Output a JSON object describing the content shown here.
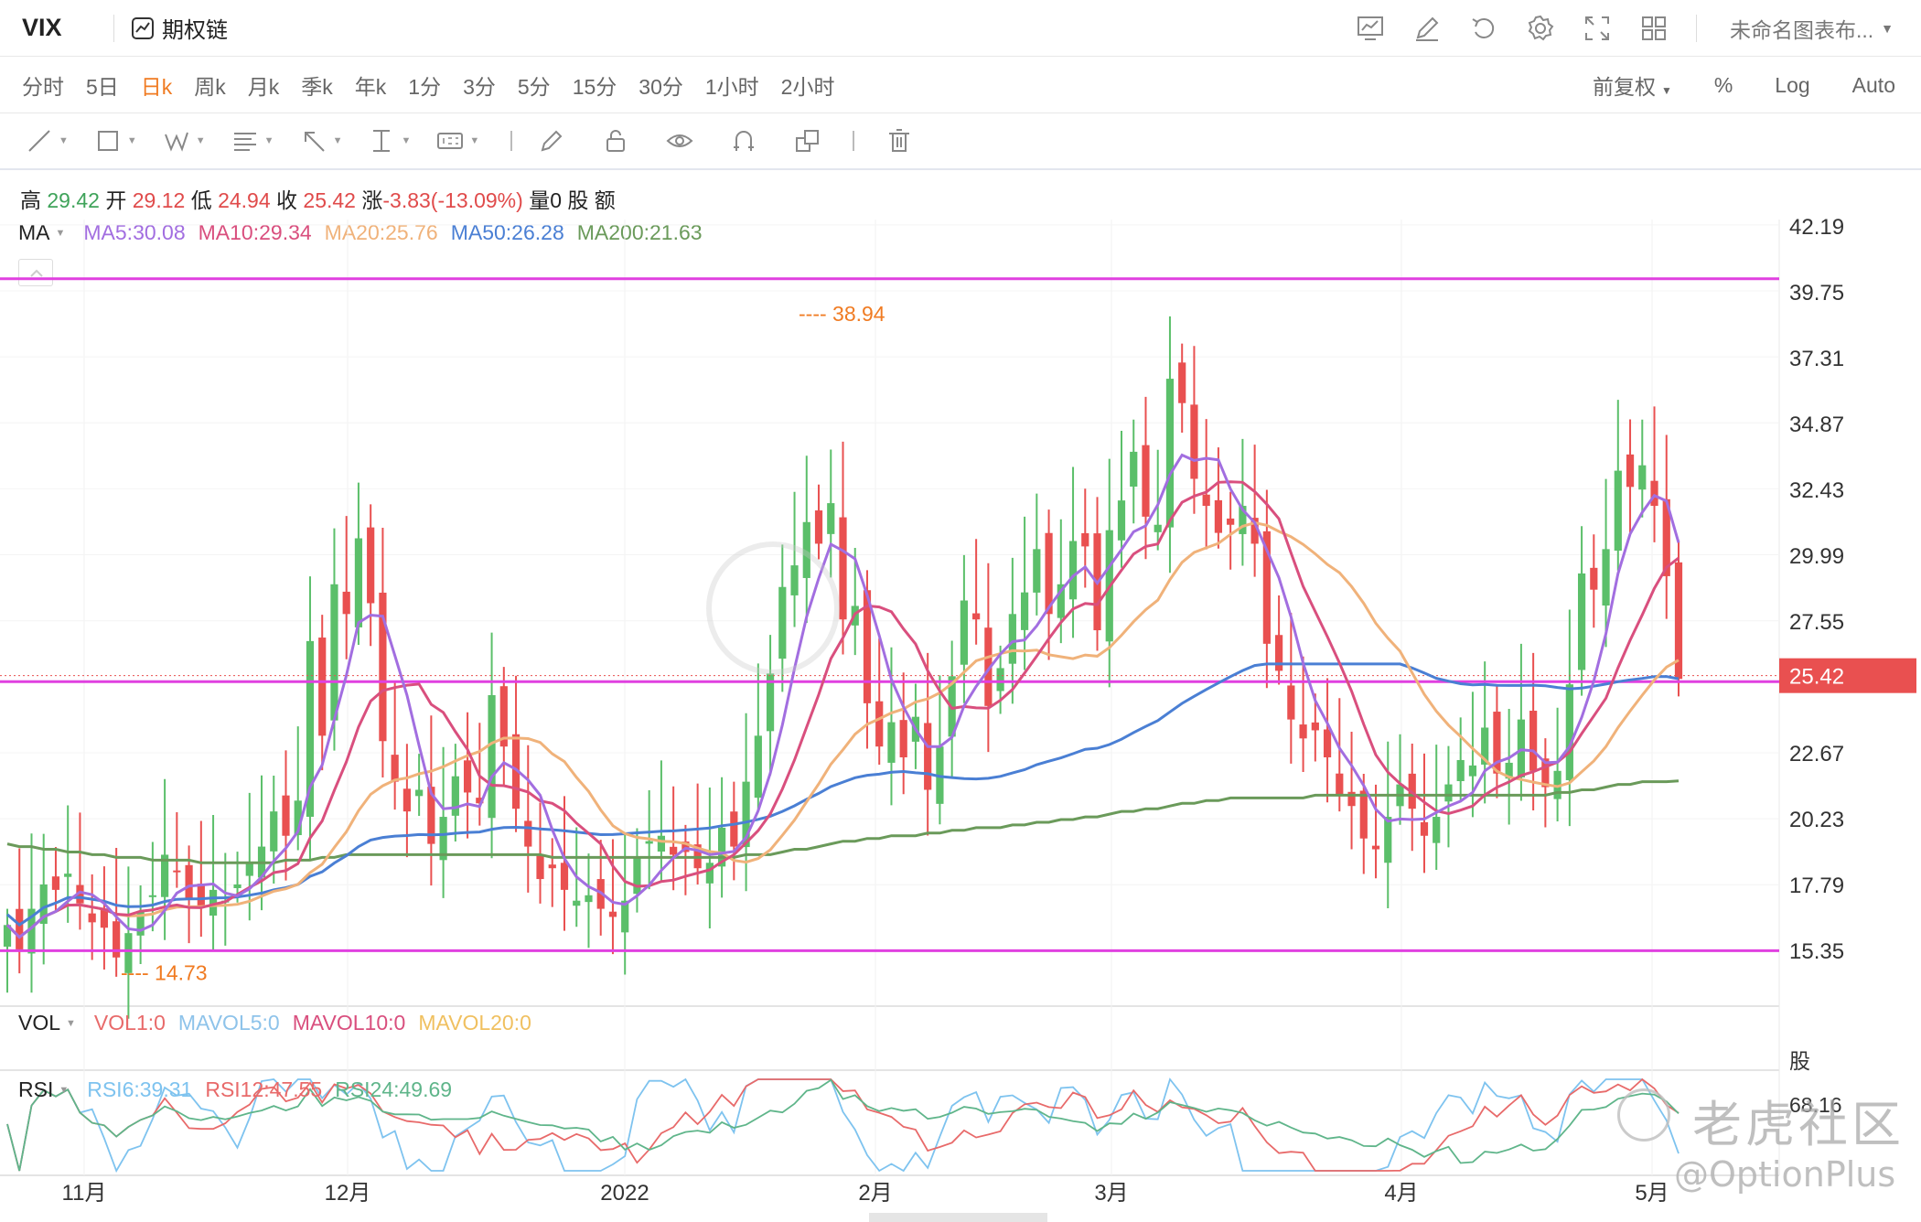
{
  "header": {
    "symbol": "VIX",
    "option_chain": "期权链",
    "layout_name": "未命名图表布...",
    "icons": [
      "indicator-icon",
      "draw-icon",
      "undo-icon",
      "settings-icon",
      "fullscreen-icon",
      "layout-grid-icon"
    ]
  },
  "periods": {
    "items": [
      "分时",
      "5日",
      "日k",
      "周k",
      "月k",
      "季k",
      "年k",
      "1分",
      "3分",
      "5分",
      "15分",
      "30分",
      "1小时",
      "2小时"
    ],
    "active": "日k",
    "right": [
      "前复权",
      "%",
      "Log",
      "Auto"
    ]
  },
  "tools": [
    "line-tool-icon",
    "rect-tool-icon",
    "pattern-tool-icon",
    "fib-tool-icon",
    "arrow-tool-icon",
    "measure-tool-icon",
    "num-tool-icon",
    "pen-tool-icon",
    "lock-icon",
    "eye-icon",
    "magnet-icon",
    "clone-icon",
    "trash-icon"
  ],
  "info": {
    "high_label": "高",
    "high": "29.42",
    "open_label": "开",
    "open": "29.12",
    "low_label": "低",
    "low": "24.94",
    "close_label": "收",
    "close": "25.42",
    "change_label": "涨",
    "change": "-3.83(-13.09%)",
    "volume_label": "量",
    "volume": "0",
    "volume_unit": "股",
    "amount_label": "额"
  },
  "ma": {
    "label": "MA",
    "items": [
      {
        "text": "MA5:30.08",
        "color": "#a26ee0"
      },
      {
        "text": "MA10:29.34",
        "color": "#d94f7e"
      },
      {
        "text": "MA20:25.76",
        "color": "#f0b27a"
      },
      {
        "text": "MA50:26.28",
        "color": "#4a7fd4"
      },
      {
        "text": "MA200:21.63",
        "color": "#6a9a5a"
      }
    ]
  },
  "vol": {
    "label": "VOL",
    "items": [
      {
        "text": "VOL1:0",
        "color": "#e86a6a"
      },
      {
        "text": "MAVOL5:0",
        "color": "#8ec3ea"
      },
      {
        "text": "MAVOL10:0",
        "color": "#d94f7e"
      },
      {
        "text": "MAVOL20:0",
        "color": "#f0c060"
      }
    ],
    "unit": "股"
  },
  "rsi": {
    "label": "RSI",
    "items": [
      {
        "text": "RSI6:39.31",
        "color": "#7ec3ef"
      },
      {
        "text": "RSI12:47.55",
        "color": "#e86a6a"
      },
      {
        "text": "RSI24:49.69",
        "color": "#5fb58a"
      }
    ],
    "axis_value": "68.16"
  },
  "watermark": {
    "line1": "老虎社区",
    "line2": "@OptionPlus"
  },
  "chart_data": {
    "type": "candlestick",
    "price_axis_ticks": [
      42.19,
      39.75,
      37.31,
      34.87,
      32.43,
      29.99,
      27.55,
      25.42,
      22.67,
      20.23,
      17.79,
      15.35
    ],
    "last_price": 25.42,
    "x_ticks": [
      "11月",
      "12月",
      "2022",
      "2月",
      "3月",
      "4月",
      "5月"
    ],
    "horizontal_lines": [
      40.2,
      25.3,
      15.35
    ],
    "annotations": [
      {
        "text": "---- 38.94",
        "price": 38.94
      },
      {
        "text": "---- 14.73",
        "price": 14.73
      }
    ],
    "colors": {
      "up": "#5bbf6a",
      "down": "#e95050",
      "hline": "#e040e0"
    },
    "close": [
      16.3,
      15.4,
      16.9,
      17.8,
      17.6,
      18.2,
      17.1,
      16.4,
      16.2,
      15.1,
      16.0,
      16.8,
      17.4,
      18.9,
      18.3,
      17.3,
      17.0,
      17.6,
      17.2,
      17.8,
      18.6,
      19.2,
      20.5,
      19.6,
      20.9,
      26.8,
      23.3,
      28.9,
      27.8,
      30.6,
      28.2,
      23.1,
      21.6,
      20.5,
      21.3,
      19.3,
      20.3,
      21.8,
      21.2,
      20.8,
      24.8,
      22.9,
      20.6,
      19.2,
      18.0,
      18.4,
      17.6,
      17.2,
      17.4,
      16.9,
      16.6,
      17.2,
      18.8,
      19.4,
      19.6,
      18.9,
      19.0,
      18.4,
      18.6,
      19.9,
      19.2,
      21.6,
      23.3,
      25.6,
      28.8,
      29.6,
      31.2,
      30.4,
      31.9,
      27.6,
      28.1,
      24.5,
      22.9,
      23.8,
      22.5,
      24.0,
      21.3,
      22.9,
      25.5,
      28.3,
      27.6,
      24.4,
      25.8,
      27.8,
      28.6,
      30.2,
      27.8,
      28.9,
      30.5,
      30.3,
      27.2,
      30.9,
      32.0,
      33.8,
      31.4,
      31.1,
      36.5,
      35.6,
      32.8,
      31.8,
      30.8,
      31.1,
      31.8,
      30.4,
      26.7,
      25.7,
      23.9,
      23.2,
      23.5,
      22.5,
      21.1,
      20.7,
      19.5,
      19.1,
      20.3,
      21.5,
      20.6,
      19.6,
      20.3,
      21.5,
      22.4,
      22.2,
      23.6,
      21.9,
      22.3,
      23.9,
      22.0,
      21.4,
      22.0,
      25.2,
      29.3,
      28.7,
      30.2,
      33.1,
      32.5,
      33.3,
      31.8,
      29.2,
      25.4
    ],
    "series": [
      {
        "name": "MA5",
        "color": "#a26ee0"
      },
      {
        "name": "MA10",
        "color": "#d94f7e"
      },
      {
        "name": "MA20",
        "color": "#f0b27a"
      },
      {
        "name": "MA50",
        "color": "#4a7fd4"
      },
      {
        "name": "MA200",
        "color": "#6a9a5a",
        "values": [
          19.3,
          19.2,
          19.2,
          19.1,
          19.1,
          19.0,
          19.0,
          18.9,
          18.9,
          18.8,
          18.8,
          18.8,
          18.7,
          18.7,
          18.7,
          18.7,
          18.6,
          18.6,
          18.6,
          18.6,
          18.6,
          18.6,
          18.6,
          18.7,
          18.7,
          18.7,
          18.8,
          18.8,
          18.9,
          18.9,
          18.9,
          18.9,
          18.9,
          18.9,
          18.9,
          18.9,
          18.9,
          18.9,
          18.9,
          18.9,
          18.9,
          18.9,
          18.9,
          18.9,
          18.9,
          18.8,
          18.8,
          18.8,
          18.8,
          18.8,
          18.8,
          18.8,
          18.8,
          18.8,
          18.8,
          18.8,
          18.8,
          18.8,
          18.8,
          18.8,
          18.8,
          18.9,
          18.9,
          18.9,
          19.0,
          19.1,
          19.1,
          19.2,
          19.3,
          19.4,
          19.4,
          19.5,
          19.5,
          19.6,
          19.6,
          19.6,
          19.7,
          19.7,
          19.8,
          19.8,
          19.9,
          19.9,
          19.9,
          20.0,
          20.0,
          20.1,
          20.1,
          20.2,
          20.2,
          20.3,
          20.3,
          20.4,
          20.5,
          20.5,
          20.6,
          20.6,
          20.7,
          20.8,
          20.8,
          20.9,
          20.9,
          21.0,
          21.0,
          21.0,
          21.0,
          21.0,
          21.0,
          21.0,
          21.1,
          21.1,
          21.1,
          21.1,
          21.1,
          21.1,
          21.1,
          21.1,
          21.1,
          21.1,
          21.1,
          21.1,
          21.1,
          21.1,
          21.1,
          21.1,
          21.1,
          21.1,
          21.1,
          21.1,
          21.2,
          21.2,
          21.3,
          21.3,
          21.4,
          21.5,
          21.5,
          21.6,
          21.6,
          21.6,
          21.63
        ]
      }
    ]
  }
}
